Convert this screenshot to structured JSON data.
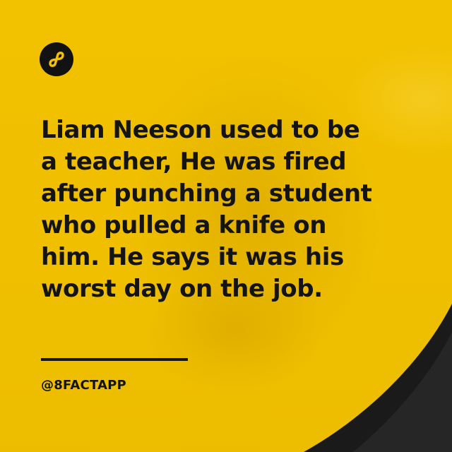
{
  "post": {
    "fact_lines": [
      "Liam Neeson used to be",
      "a teacher, He was fired",
      "after punching a student",
      "who pulled a knife on",
      "him. He says it was his",
      "worst day on the job."
    ],
    "handle": "@8FACTAPP"
  },
  "brand": {
    "logo_icon": "infinity-eight-icon",
    "accent_color": "#f2c200",
    "text_color": "#141414",
    "corner_color": "#1a1a1a"
  }
}
